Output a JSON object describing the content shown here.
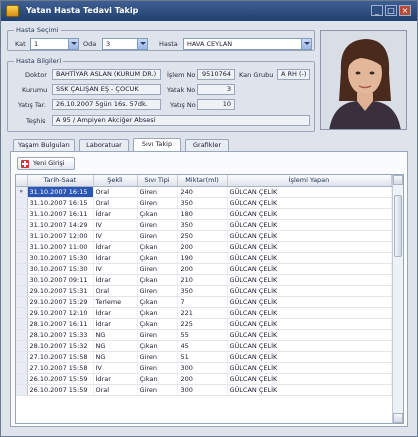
{
  "window": {
    "title": "Yatan Hasta Tedavi Takip",
    "icon": "app-icon",
    "controls": {
      "minimize": "_",
      "maximize": "□",
      "close": "×"
    }
  },
  "patient_select": {
    "group_title": "Hasta Seçimi",
    "kat_label": "Kat",
    "kat_value": "1",
    "oda_label": "Oda",
    "oda_value": "3",
    "hasta_label": "Hasta",
    "hasta_value": "HAVA CEYLAN"
  },
  "patient_info": {
    "group_title": "Hasta Bilgileri",
    "doktor_label": "Doktor",
    "doktor_value": "BAHTİYAR ASLAN (KURUM DR.)",
    "islem_no_label": "İşlem No",
    "islem_no_value": "9510764",
    "kan_grubu_label": "Kan Grubu",
    "kan_grubu_value": "A RH (-)",
    "kurumu_label": "Kurumu",
    "kurumu_value": "SSK ÇALIŞAN EŞ - ÇOCUK",
    "yatak_no_label": "Yatak No",
    "yatak_no_value": "3",
    "yatis_tar_label": "Yatış Tar.",
    "yatis_tar_value": "26.10.2007  5gün 16s. 57dk.",
    "yatis_no_label": "Yatış No",
    "yatis_no_value": "10",
    "teshis_label": "Teşhis",
    "teshis_value": "A 95 / Ampiyen Akciğer Absesi"
  },
  "tabs": [
    {
      "label": "Yaşam Bulguları",
      "active": false
    },
    {
      "label": "Laboratuar",
      "active": false
    },
    {
      "label": "Sıvı Takip",
      "active": true
    },
    {
      "label": "Grafikler",
      "active": false
    }
  ],
  "toolbar": {
    "add_label": "Yeni Girişi"
  },
  "grid": {
    "columns": [
      "Tarih-Saat",
      "Şekli",
      "Sıvı Tipi",
      "Miktar(ml)",
      "İşlemi Yapan"
    ],
    "current_row_marker": "»",
    "rows": [
      [
        "31.10.2007 16:15",
        "Oral",
        "Giren",
        "240",
        "GÜLCAN ÇELİK"
      ],
      [
        "31.10.2007 16:15",
        "Oral",
        "Giren",
        "350",
        "GÜLCAN ÇELİK"
      ],
      [
        "31.10.2007 16:11",
        "İdrar",
        "Çıkan",
        "180",
        "GÜLCAN ÇELİK"
      ],
      [
        "31.10.2007 14:29",
        "IV",
        "Giren",
        "350",
        "GÜLCAN ÇELİK"
      ],
      [
        "31.10.2007 12:00",
        "IV",
        "Giren",
        "250",
        "GÜLCAN ÇELİK"
      ],
      [
        "31.10.2007 11:00",
        "İdrar",
        "Çıkan",
        "200",
        "GÜLCAN ÇELİK"
      ],
      [
        "30.10.2007 15:30",
        "İdrar",
        "Çıkan",
        "190",
        "GÜLCAN ÇELİK"
      ],
      [
        "30.10.2007 15:30",
        "IV",
        "Giren",
        "200",
        "GÜLCAN ÇELİK"
      ],
      [
        "30.10.2007 09:11",
        "İdrar",
        "Çıkan",
        "210",
        "GÜLCAN ÇELİK"
      ],
      [
        "29.10.2007 15:31",
        "Oral",
        "Giren",
        "350",
        "GÜLCAN ÇELİK"
      ],
      [
        "29.10.2007 15:29",
        "Terleme",
        "Çıkan",
        "7",
        "GÜLCAN ÇELİK"
      ],
      [
        "29.10.2007 12:10",
        "İdrar",
        "Çıkan",
        "221",
        "GÜLCAN ÇELİK"
      ],
      [
        "28.10.2007 16:11",
        "İdrar",
        "Çıkan",
        "225",
        "GÜLCAN ÇELİK"
      ],
      [
        "28.10.2007 15:33",
        "NG",
        "Giren",
        "55",
        "GÜLCAN ÇELİK"
      ],
      [
        "28.10.2007 15:32",
        "NG",
        "Çıkan",
        "45",
        "GÜLCAN ÇELİK"
      ],
      [
        "27.10.2007 15:58",
        "NG",
        "Giren",
        "51",
        "GÜLCAN ÇELİK"
      ],
      [
        "27.10.2007 15:58",
        "IV",
        "Giren",
        "300",
        "GÜLCAN ÇELİK"
      ],
      [
        "26.10.2007 15:59",
        "İdrar",
        "Çıkan",
        "200",
        "GÜLCAN ÇELİK"
      ],
      [
        "26.10.2007 15:59",
        "Oral",
        "Giren",
        "300",
        "GÜLCAN ÇELİK"
      ]
    ]
  },
  "colors": {
    "titlebar": "#2c4a7e",
    "selection": "#2c56b5",
    "accent_red": "#d8342c"
  }
}
